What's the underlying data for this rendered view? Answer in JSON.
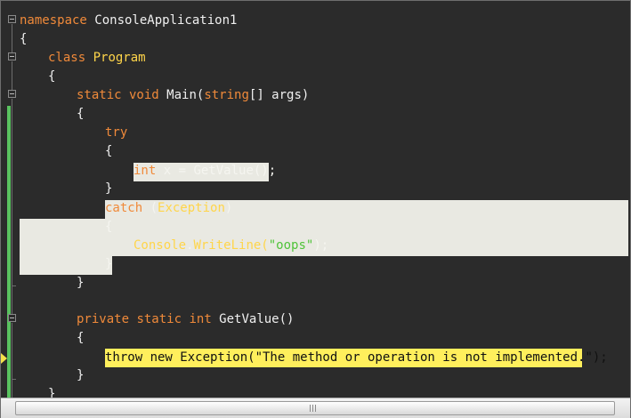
{
  "editor": {
    "lines": {
      "l1": {
        "kw": "namespace",
        "rest": " ConsoleApplication1"
      },
      "l2": "{",
      "l3": {
        "kw": "class",
        "type": " Program"
      },
      "l4": "{",
      "l5": {
        "kw1": "static",
        "kw2": " void",
        "name": " Main(",
        "type": "string",
        "rest": "[] args)"
      },
      "l6": "{",
      "l7": {
        "kw": "try"
      },
      "l8": "{",
      "l9": {
        "kw": "int",
        "rest": " x = GetValue();"
      },
      "l10": "}",
      "l11": {
        "kw": "catch",
        "open": " (",
        "type": "Exception",
        "close": ")"
      },
      "l12": "{",
      "l13": {
        "type": "Console",
        "dot": ".",
        "method": "WriteLine(",
        "str": "\"oops\"",
        "end": ");"
      },
      "l14": "}",
      "l15": "}",
      "l16": {
        "kw1": "private",
        "kw2": " static",
        "kw3": " int",
        "rest": " GetValue()"
      },
      "l17": "{",
      "l18": "throw new Exception(\"The method or operation is not implemented.\");",
      "l19": "}",
      "l20": "}"
    },
    "colors": {
      "background": "#2b2b2b",
      "keyword": "#f08a3a",
      "type": "#ffd54a",
      "string": "#7cd655",
      "selection": "#e9e9e2",
      "current_statement": "#ffef5c",
      "change_bar": "#59c25f"
    }
  }
}
